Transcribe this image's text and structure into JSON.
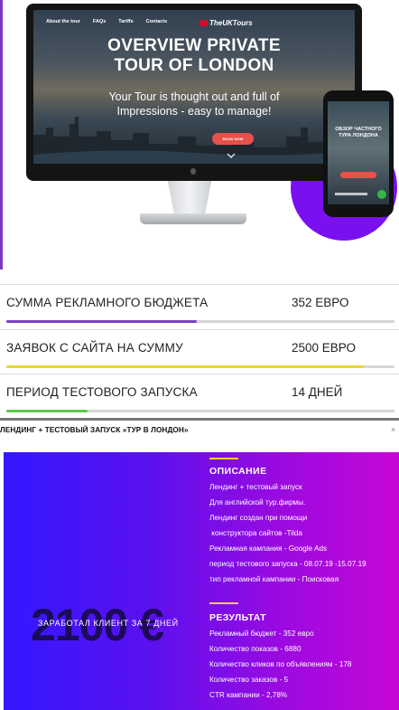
{
  "hero": {
    "nav": [
      "About the tour",
      "FAQs",
      "Tariffs",
      "Contacts"
    ],
    "logo": "TheUKTours",
    "title_line1": "OVERVIEW PRIVATE",
    "title_line2": "TOUR OF LONDON",
    "subtitle_line1": "Your Tour is thought out and full of",
    "subtitle_line2": "Impressions - easy to manage!",
    "button": "BOOK NOW",
    "phone_title_line1": "ОБЗОР ЧАСТНОГО",
    "phone_title_line2": "ТУРА ЛОНДОНА"
  },
  "stats": [
    {
      "label": "СУММА РЕКЛАМНОГО БЮДЖЕТА",
      "value": "352 ЕВРО",
      "bar_color": "#7b3fc4",
      "bar_fraction": 0.49
    },
    {
      "label": "ЗАЯВОК С САЙТА НА СУММУ",
      "value": "2500 ЕВРО",
      "bar_color": "#e8d82a",
      "bar_fraction": 0.92
    },
    {
      "label": "ПЕРИОД ТЕСТОВОГО ЗАПУСКА",
      "value": "14 ДНЕЙ",
      "bar_color": "#5cc84a",
      "bar_fraction": 0.21
    }
  ],
  "case": {
    "title": "ЛЕНДИНГ + ТЕСТОВЫЙ ЗАПУСК «ТУР В ЛОНДОН»",
    "close": "×",
    "big_number": "2100 €",
    "earned_label": "ЗАРАБОТАЛ КЛИЕНТ ЗА 7 ДНЕЙ",
    "description": {
      "heading": "ОПИСАНИЕ",
      "lines": [
        "Лендинг + тестовый запуск",
        "Для английской тур.фирмы.",
        "Лендинг создан при помощи",
        " конструктора сайтов -Tilda",
        "Рекламная кампания - Google Ads",
        "период тестового запуска - 08.07.19 -15.07.19",
        "тип рекламной кампании - Поисковая"
      ]
    },
    "result": {
      "heading": "РЕЗУЛЬТАТ",
      "lines": [
        "Рекламный бюджет - 352 евро",
        "Количество показов - 6880",
        "Количество кликов по объявлениям - 178",
        "Количество заказов - 5",
        "CTR кампании - 2,78%"
      ]
    }
  }
}
